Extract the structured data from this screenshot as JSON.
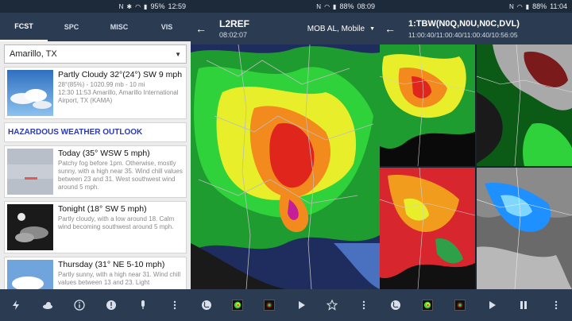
{
  "screens": [
    {
      "status": {
        "battery": "95%",
        "time": "12:59"
      },
      "tabs": [
        "FCST",
        "SPC",
        "MISC",
        "VIS"
      ],
      "location": "Amarillo, TX",
      "current": {
        "headline": "Partly Cloudy 32°(24°) SW 9 mph",
        "detail": "28°(85%) - 1020.99 mb - 10 mi\n12:30 11:53 Amarillo, Amarillo International Airport, TX (KAMA)"
      },
      "hazard": "HAZARDOUS WEATHER OUTLOOK",
      "forecasts": [
        {
          "headline": "Today (35° WSW 5 mph)",
          "detail": "Patchy fog before 1pm. Otherwise, mostly sunny, with a high near 35. Wind chill values between 23 and 31. West southwest wind around 5 mph."
        },
        {
          "headline": "Tonight (18° SW 5 mph)",
          "detail": "Partly cloudy, with a low around 18. Calm wind becoming southwest around 5 mph."
        },
        {
          "headline": "Thursday (31° NE 5-10 mph)",
          "detail": "Partly sunny, with a high near 31. Wind chill values between 13 and 23. Light"
        }
      ]
    },
    {
      "status": {
        "battery": "88%",
        "time": "08:09"
      },
      "title": "L2REF",
      "time": "08:02:07",
      "site": "MOB AL, Mobile"
    },
    {
      "status": {
        "battery": "88%",
        "time": "11:04"
      },
      "title": "1:TBW(N0Q,N0U,N0C,DVL)",
      "times": "11:00:40/11:00:40/11:00:40/10:56:05"
    }
  ],
  "icons": {
    "status": [
      "notification-n-icon",
      "bluetooth-icon",
      "vibrate-icon",
      "wifi-icon",
      "signal-icon",
      "battery-icon"
    ],
    "bottom1": [
      "lightning-icon",
      "cloud-icon",
      "info-icon",
      "alert-icon",
      "mic-icon",
      "more-vert-icon"
    ],
    "bottom2": [
      "globe-icon",
      "play-icon",
      "star-icon",
      "more-vert-icon"
    ],
    "bottom3": [
      "globe-icon",
      "play-icon",
      "pause-icon",
      "more-vert-icon"
    ]
  },
  "colors": {
    "appbar": "#2b3b52",
    "hazard": "#2c3ab3"
  }
}
